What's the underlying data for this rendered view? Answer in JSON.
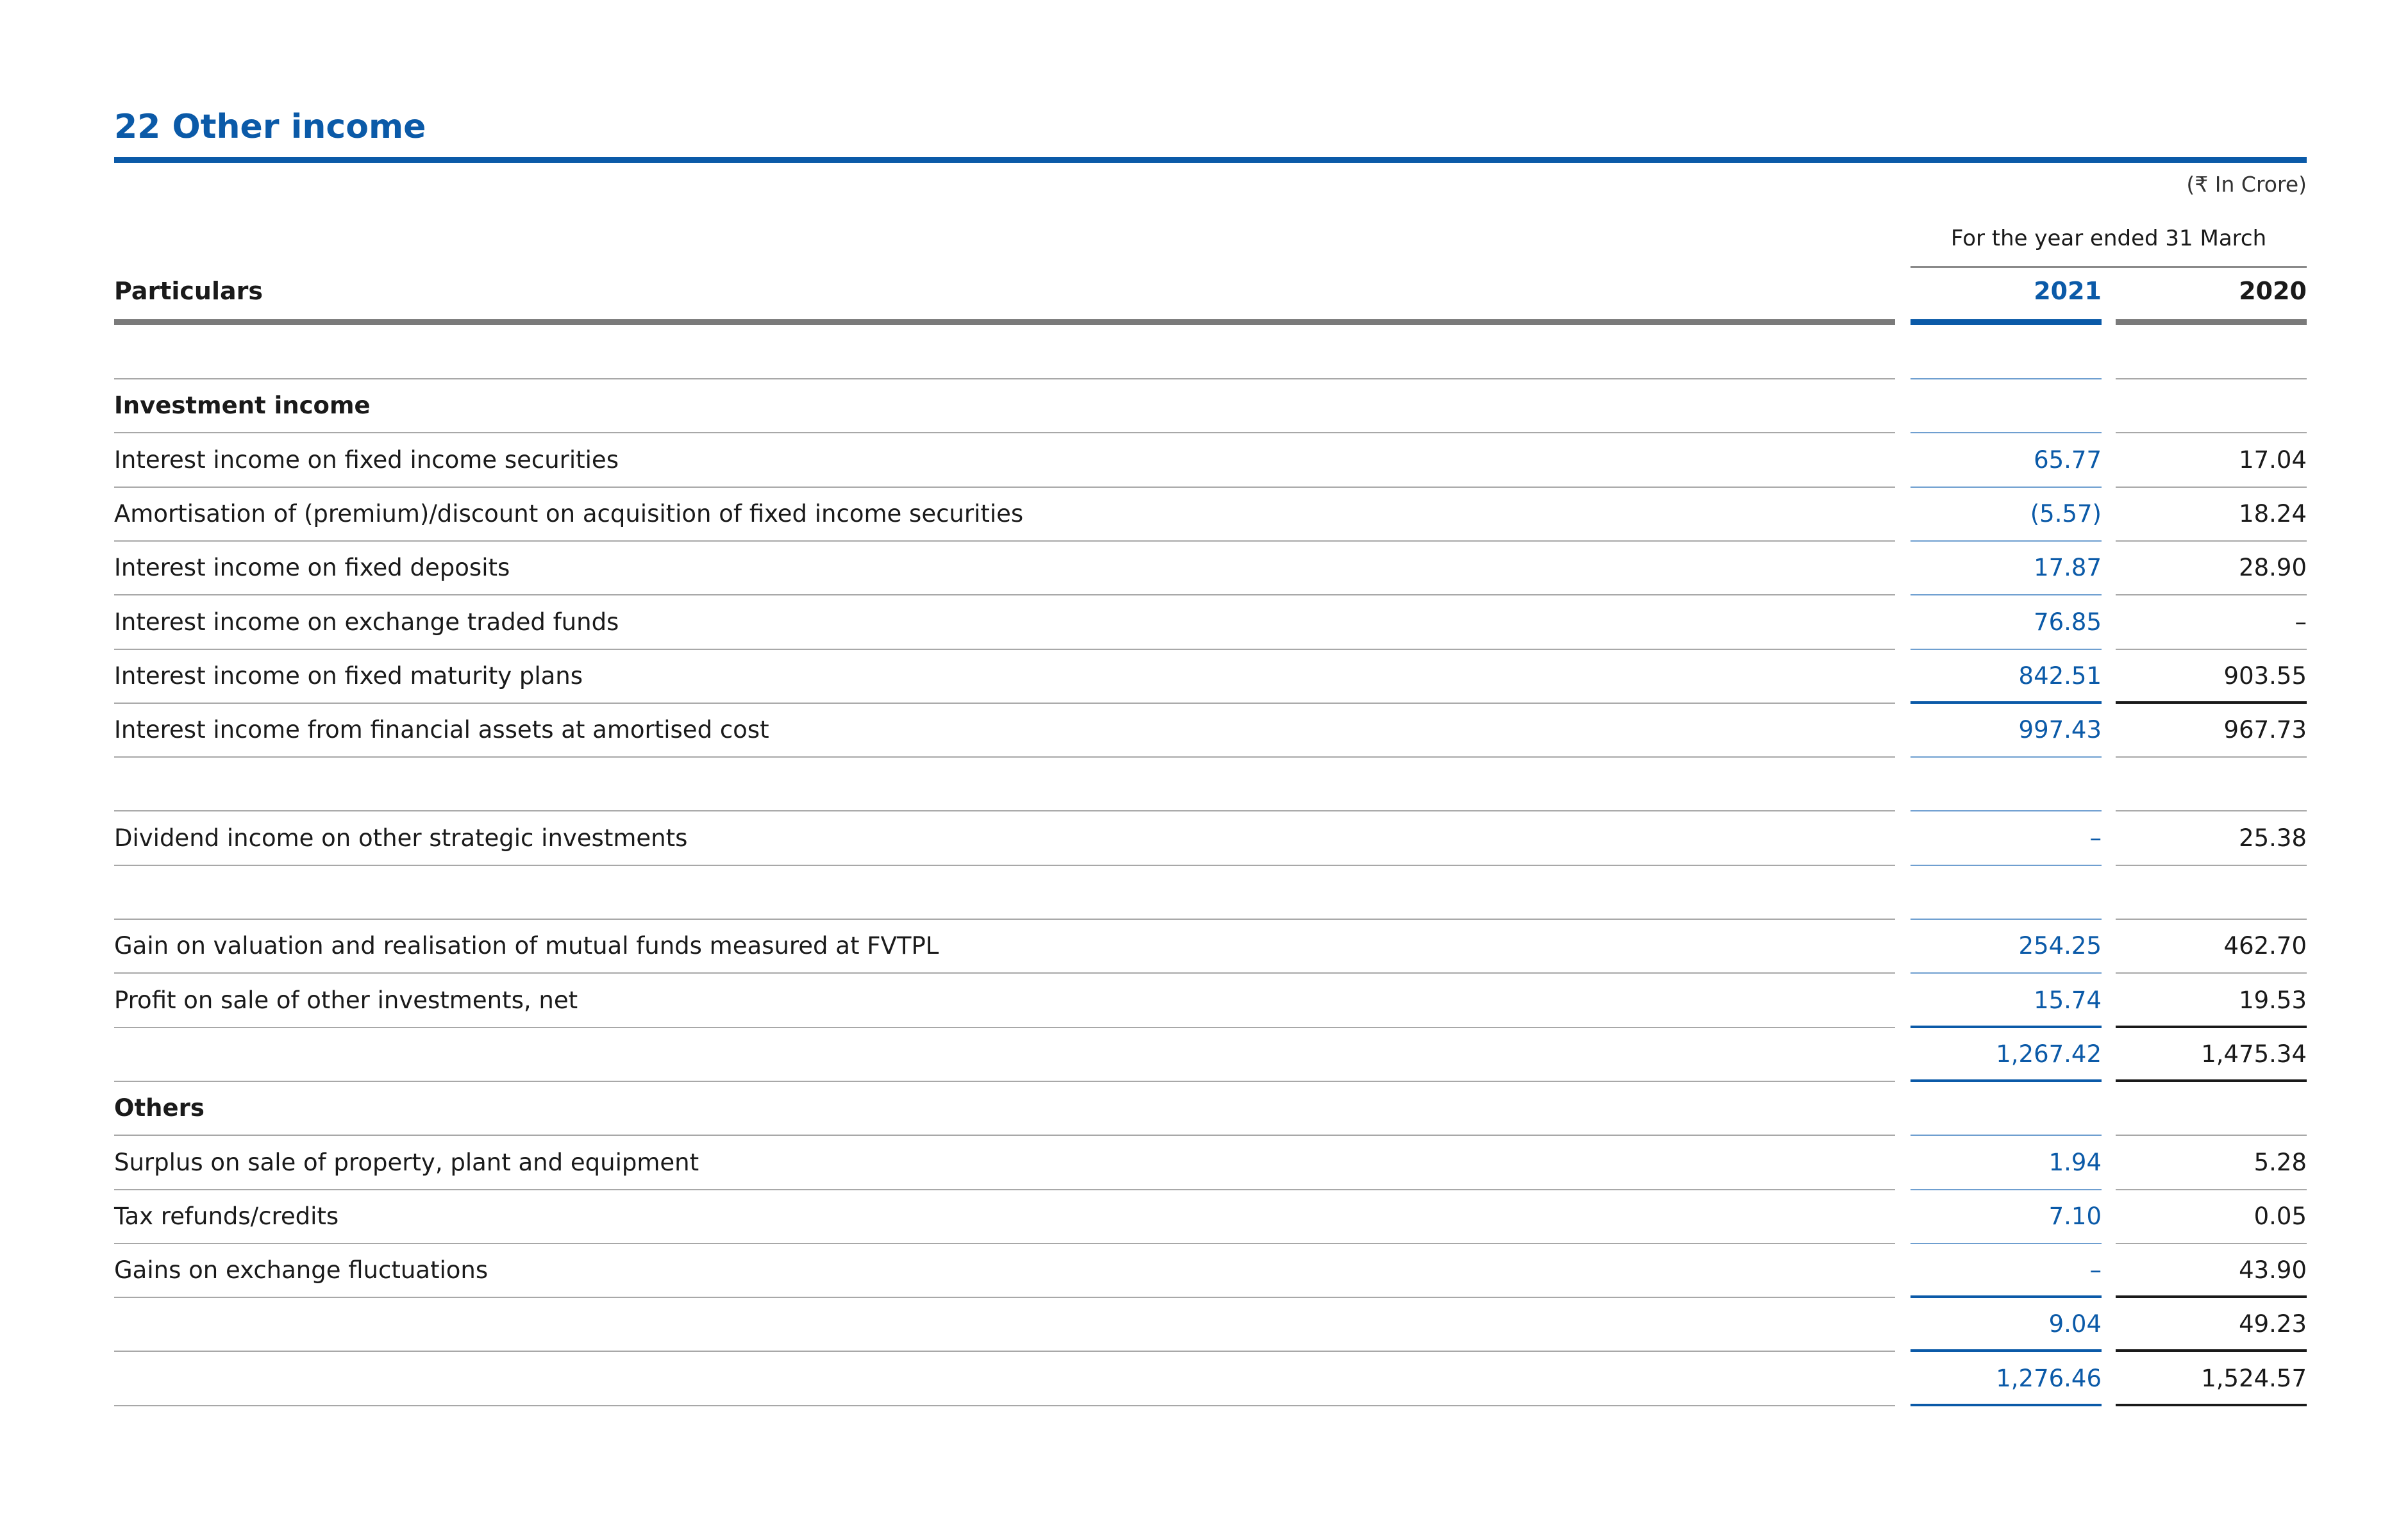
{
  "title": "22 Other income",
  "unit": "(₹ In Crore)",
  "period_label": "For the year ended 31 March",
  "columns": {
    "particulars": "Particulars",
    "year1": "2021",
    "year2": "2020"
  },
  "rows": [
    {
      "label": "",
      "v1": "",
      "v2": ""
    },
    {
      "label": "Investment income",
      "bold": true,
      "v1": "",
      "v2": ""
    },
    {
      "label": "Interest income on fixed income securities",
      "v1": "65.77",
      "v2": "17.04"
    },
    {
      "label": "Amortisation of (premium)/discount on acquisition of fixed income securities",
      "v1": "(5.57)",
      "v2": "18.24"
    },
    {
      "label": "Interest income on fixed deposits",
      "v1": "17.87",
      "v2": "28.90"
    },
    {
      "label": "Interest income on exchange traded funds",
      "v1": "76.85",
      "v2": "–"
    },
    {
      "label": "Interest income on fixed maturity plans",
      "v1": "842.51",
      "v2": "903.55",
      "underline": true
    },
    {
      "label": "Interest income from financial assets at amortised cost",
      "v1": "997.43",
      "v2": "967.73"
    },
    {
      "label": "",
      "v1": "",
      "v2": ""
    },
    {
      "label": "Dividend income on other strategic investments",
      "v1": "–",
      "v2": "25.38"
    },
    {
      "label": "",
      "v1": "",
      "v2": ""
    },
    {
      "label": "Gain on valuation and realisation of mutual funds measured at FVTPL",
      "v1": "254.25",
      "v2": "462.70"
    },
    {
      "label": "Profit on sale of other investments, net",
      "v1": "15.74",
      "v2": "19.53",
      "underline": true
    },
    {
      "label": "",
      "v1": "1,267.42",
      "v2": "1,475.34",
      "underline": true
    },
    {
      "label": "Others",
      "bold": true,
      "v1": "",
      "v2": ""
    },
    {
      "label": "Surplus on sale of property, plant and equipment",
      "v1": "1.94",
      "v2": "5.28"
    },
    {
      "label": "Tax refunds/credits",
      "v1": "7.10",
      "v2": "0.05"
    },
    {
      "label": "Gains on exchange fluctuations",
      "v1": "–",
      "v2": "43.90",
      "underline": true
    },
    {
      "label": "",
      "v1": "9.04",
      "v2": "49.23",
      "underline": true
    },
    {
      "label": "",
      "v1": "1,276.46",
      "v2": "1,524.57",
      "underline": true
    }
  ]
}
